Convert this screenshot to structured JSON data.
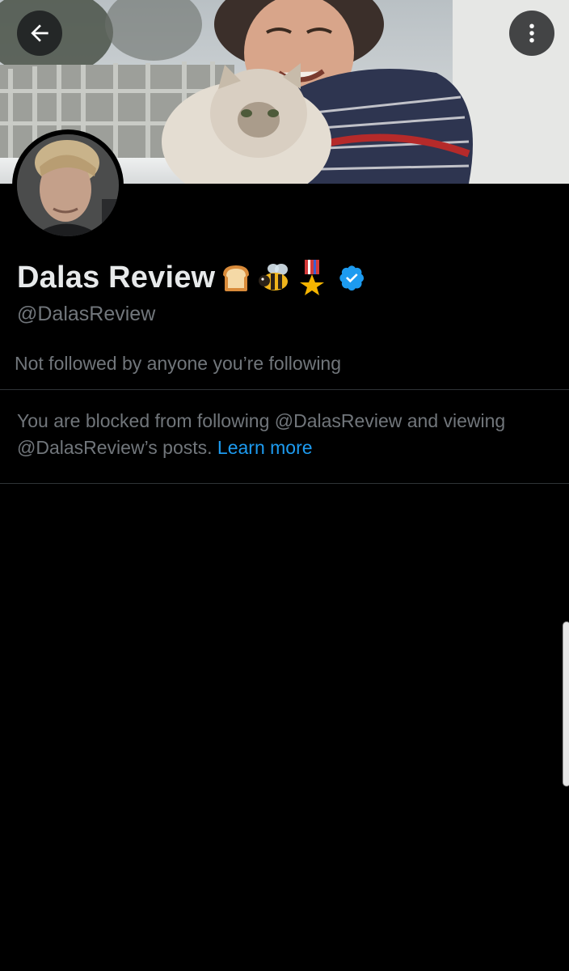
{
  "profile": {
    "display_name": "Dalas Review",
    "name_emojis": [
      "bread-icon",
      "bee-icon",
      "medal-icon"
    ],
    "verified": true,
    "handle": "@DalasReview",
    "followed_by_text": "Not followed by anyone you’re following"
  },
  "blocked": {
    "message": "You are blocked from following @DalasReview and viewing @DalasReview’s posts.",
    "link_label": "Learn more"
  },
  "icons": {
    "back": "arrow-left-icon",
    "more": "more-vertical-icon",
    "verified": "verified-badge-icon"
  },
  "colors": {
    "background": "#000000",
    "primary_text": "#e7e9ea",
    "secondary_text": "#71767b",
    "link": "#1d9bf0",
    "verified": "#1d9bf0",
    "divider": "#2f3336"
  }
}
